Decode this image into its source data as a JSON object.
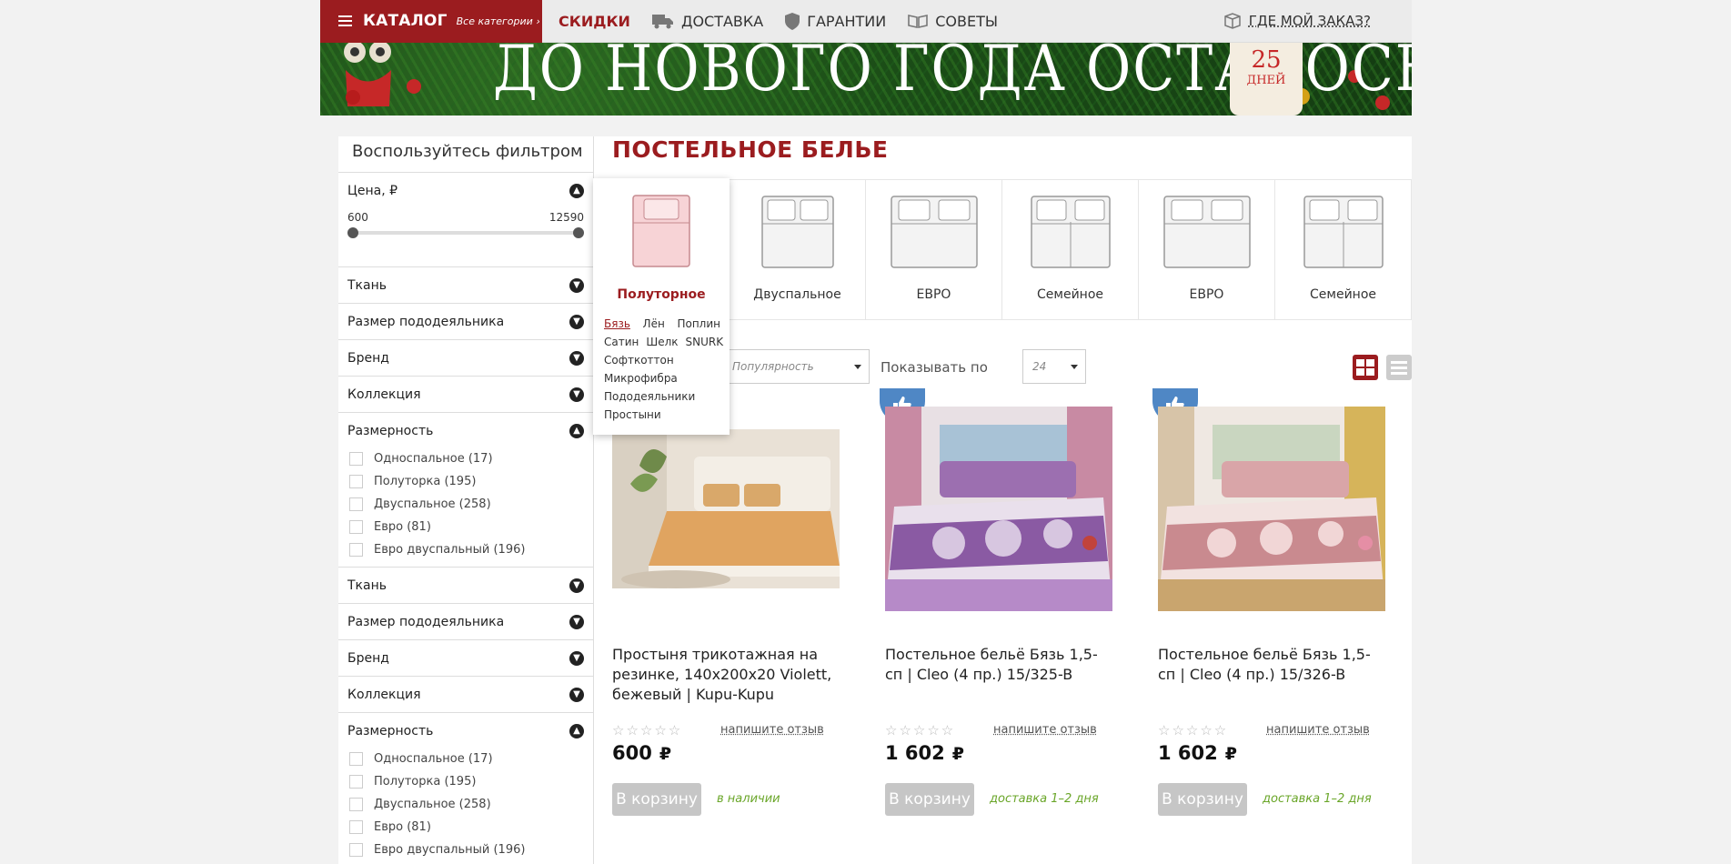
{
  "nav": {
    "catalog": "КАТАЛОГ",
    "all_categories": "Все категории ›",
    "items": [
      "СКИДКИ",
      "ДОСТАВКА",
      "ГАРАНТИИ",
      "СОВЕТЫ"
    ],
    "order": "ГДЕ МОЙ ЗАКАЗ?"
  },
  "banner": {
    "text": "ДО НОВОГО ГОДА ОСТАЛОСЬ",
    "days_number": "25",
    "days_word": "ДНЕЙ"
  },
  "filter": {
    "title": "Воспользуйтесь фильтром",
    "price_label": "Цена, ₽",
    "price_min": "600",
    "price_max": "12590",
    "groups1": [
      "Ткань",
      "Размер пододеяльника",
      "Бренд",
      "Коллекция"
    ],
    "dim_label": "Размерность",
    "dims": [
      "Односпальное (17)",
      "Полуторка (195)",
      "Двуспальное (258)",
      "Евро (81)",
      "Евро двуспальный (196)"
    ],
    "groups2": [
      "Ткань",
      "Размер пододеяльника",
      "Бренд",
      "Коллекция"
    ],
    "dim_label2": "Размерность",
    "dims2": [
      "Односпальное (17)",
      "Полуторка (195)",
      "Двуспальное (258)",
      "Евро (81)",
      "Евро двуспальный (196)"
    ]
  },
  "page_title": "ПОСТЕЛЬНОЕ БЕЛЬЕ",
  "sizes": [
    "Полуторное",
    "Двуспальное",
    "ЕВРО",
    "Семейное",
    "ЕВРО",
    "Семейное"
  ],
  "dropdown": {
    "links": [
      "Бязь",
      "Лён",
      "Поплин",
      "Сатин",
      "Шелк",
      "SNURK",
      "Софткоттон",
      "Микрофибра",
      "Пододеяльники",
      "Простыни"
    ]
  },
  "toolbar": {
    "sort_value": "Популярность",
    "per_page_label": "Показывать по",
    "per_page_value": "24"
  },
  "products": [
    {
      "name": "Простыня трикотажная на резинке, 140х200х20 Violett, бежевый | Kupu-Kupu",
      "stars": "☆☆☆☆☆",
      "review": "напишите отзыв",
      "price": "600",
      "currency": "₽",
      "cart": "В корзину",
      "stock": "в наличии"
    },
    {
      "name": "Постельное бельё Бязь 1,5-сп | Cleo (4 пр.) 15/325-B",
      "stars": "☆☆☆☆☆",
      "review": "напишите отзыв",
      "price": "1 602",
      "currency": "₽",
      "cart": "В корзину",
      "stock": "доставка 1–2 дня"
    },
    {
      "name": "Постельное бельё Бязь 1,5-сп | Cleo (4 пр.) 15/326-B",
      "stars": "☆☆☆☆☆",
      "review": "напишите отзыв",
      "price": "1 602",
      "currency": "₽",
      "cart": "В корзину",
      "stock": "доставка 1–2 дня"
    }
  ],
  "colors": {
    "brand": "#9b1c1f",
    "badge": "#4f87c5",
    "stock": "#6aa629"
  }
}
